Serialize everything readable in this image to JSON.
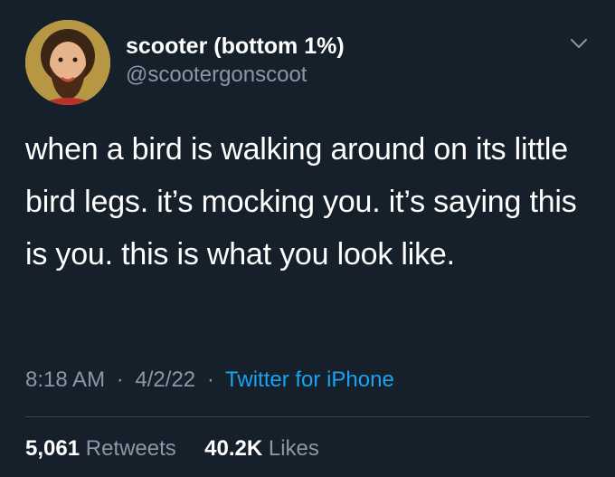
{
  "author": {
    "display_name": "scooter (bottom 1%)",
    "handle": "@scootergonscoot"
  },
  "tweet": {
    "text": "when a bird is walking around on its little bird legs. it’s mocking you. it’s saying this is you. this is what you look like."
  },
  "meta": {
    "time": "8:18 AM",
    "separator": "·",
    "date": "4/2/22",
    "source": "Twitter for iPhone"
  },
  "stats": {
    "retweets_count": "5,061",
    "retweets_label": "Retweets",
    "likes_count": "40.2K",
    "likes_label": "Likes"
  },
  "icons": {
    "more": "chevron-down-icon",
    "avatar": "avatar"
  },
  "colors": {
    "background": "#15202b",
    "primary_text": "#ffffff",
    "secondary_text": "#8899a6",
    "link": "#1da1f2",
    "divider": "#38444d"
  }
}
